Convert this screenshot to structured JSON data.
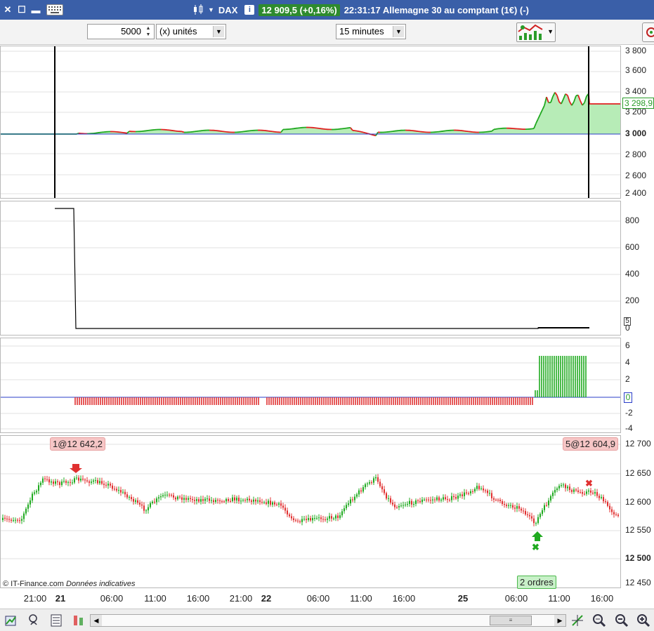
{
  "window": {
    "instrument": "DAX",
    "price_badge": "12 909,5 (+0,16%)",
    "status": "22:31:17 Allemagne 30 au comptant (1€) (-)",
    "info_glyph": "i",
    "icons": [
      "close-icon",
      "maximize-icon",
      "keyboard-icon",
      "candles-icon",
      "info-icon"
    ]
  },
  "toolbar": {
    "quantity": "5000",
    "units": "(x) unités",
    "timeframe": "15 minutes"
  },
  "panel_equity": {
    "ticks": [
      {
        "label": "3 800",
        "bold": false
      },
      {
        "label": "3 600",
        "bold": false
      },
      {
        "label": "3 400",
        "bold": false
      },
      {
        "label": "3 200",
        "bold": false
      },
      {
        "label": "3 000",
        "bold": true
      },
      {
        "label": "2 800",
        "bold": false
      },
      {
        "label": "2 600",
        "bold": false
      },
      {
        "label": "2 400",
        "bold": false
      }
    ],
    "current_value": "3 298,9",
    "colors": {
      "up": "#1fa81f",
      "down": "#e02020",
      "fill": "#b7ecb7",
      "baseline": "#2a3dc8"
    }
  },
  "panel_position": {
    "ticks": [
      "800",
      "600",
      "400",
      "200",
      "0"
    ],
    "current_value": "5"
  },
  "panel_histogram": {
    "ticks": [
      "6",
      "4",
      "2",
      "0",
      "-2",
      "-4"
    ],
    "current_value": "0"
  },
  "panel_price": {
    "ticks": [
      {
        "label": "12 700",
        "bold": false
      },
      {
        "label": "12 650",
        "bold": false
      },
      {
        "label": "12 600",
        "bold": false
      },
      {
        "label": "12 550",
        "bold": false
      },
      {
        "label": "12 500",
        "bold": true
      },
      {
        "label": "12 450",
        "bold": false
      }
    ],
    "order_open": "1@12 642,2",
    "order_close": "5@12 604,9",
    "orders_tag": "2 ordres",
    "copyright": "© IT-Finance.com",
    "disclaimer": "Données indicatives"
  },
  "time_axis": [
    {
      "label": "21:00",
      "day": false
    },
    {
      "label": "21",
      "day": true
    },
    {
      "label": "06:00",
      "day": false
    },
    {
      "label": "11:00",
      "day": false
    },
    {
      "label": "16:00",
      "day": false
    },
    {
      "label": "21:00",
      "day": false
    },
    {
      "label": "22",
      "day": true
    },
    {
      "label": "06:00",
      "day": false
    },
    {
      "label": "11:00",
      "day": false
    },
    {
      "label": "16:00",
      "day": false
    },
    {
      "label": "25",
      "day": true
    },
    {
      "label": "06:00",
      "day": false
    },
    {
      "label": "11:00",
      "day": false
    },
    {
      "label": "16:00",
      "day": false
    }
  ],
  "bottom_icons": [
    "add-chart-icon",
    "indicators-icon",
    "properties-icon",
    "trading-icon",
    "scroll-left-icon",
    "scroll-right-icon",
    "crosshair-icon",
    "zoom-fit-icon",
    "zoom-out-icon",
    "zoom-in-icon"
  ]
}
